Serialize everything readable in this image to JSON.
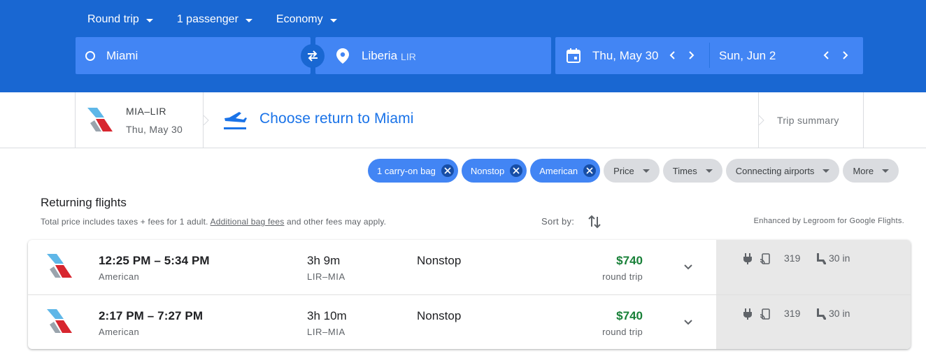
{
  "search": {
    "trip_type": "Round trip",
    "passengers": "1 passenger",
    "cabin": "Economy",
    "origin": "Miami",
    "destination": "Liberia",
    "destination_code": "LIR",
    "depart_date": "Thu, May 30",
    "return_date": "Sun, Jun 2"
  },
  "steps": {
    "outbound_route": "MIA–LIR",
    "outbound_date": "Thu, May 30",
    "current_step": "Choose return to Miami",
    "summary": "Trip summary"
  },
  "filters": {
    "active": [
      "1 carry-on bag",
      "Nonstop",
      "American"
    ],
    "menus": [
      "Price",
      "Times",
      "Connecting airports",
      "More"
    ]
  },
  "results": {
    "title": "Returning flights",
    "subtitle_pre": "Total price includes taxes + fees for 1 adult. ",
    "subtitle_link": "Additional bag fees",
    "subtitle_post": " and other fees may apply.",
    "sort_label": "Sort by:",
    "enhanced": "Enhanced by Legroom for Google Flights."
  },
  "flights": [
    {
      "times": "12:25 PM – 5:34 PM",
      "airline": "American",
      "duration": "3h 9m",
      "route": "LIR–MIA",
      "stops": "Nonstop",
      "price": "$740",
      "price_type": "round trip",
      "aircraft": "319",
      "legroom": "30 in"
    },
    {
      "times": "2:17 PM – 7:27 PM",
      "airline": "American",
      "duration": "3h 10m",
      "route": "LIR–MIA",
      "stops": "Nonstop",
      "price": "$740",
      "price_type": "round trip",
      "aircraft": "319",
      "legroom": "30 in"
    }
  ],
  "colors": {
    "header_blue": "#1967d2",
    "field_blue": "#4285f4",
    "link_blue": "#1a73e8",
    "price_green": "#188038"
  },
  "icons": [
    "origin-circle-icon",
    "swap-icon",
    "location-pin-icon",
    "calendar-icon",
    "chevron-left-icon",
    "chevron-right-icon",
    "airline-logo-icon",
    "return-plane-icon",
    "sort-icon",
    "close-icon",
    "expand-icon",
    "power-outlet-icon",
    "mobile-stream-icon",
    "legroom-icon"
  ]
}
